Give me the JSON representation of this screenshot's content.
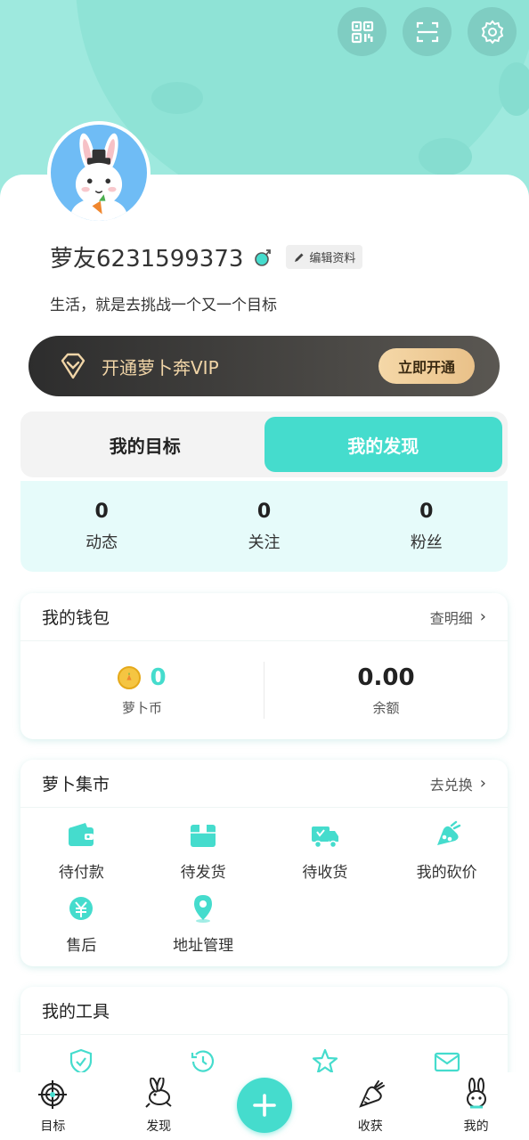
{
  "colors": {
    "accent": "#45dccd",
    "hero_bg": "#9ee9de",
    "vip_gold": "#f1d5a7"
  },
  "header": {
    "icons": [
      "qrcode-icon",
      "scan-icon",
      "settings-icon"
    ]
  },
  "profile": {
    "username": "萝友6231599373",
    "edit_label": "编辑资料",
    "bio": "生活，就是去挑战一个又一个目标"
  },
  "vip": {
    "text": "开通萝卜奔VIP",
    "button": "立即开通"
  },
  "tabs": [
    {
      "label": "我的目标",
      "active": false
    },
    {
      "label": "我的发现",
      "active": true
    }
  ],
  "stats": [
    {
      "value": "0",
      "label": "动态"
    },
    {
      "value": "0",
      "label": "关注"
    },
    {
      "value": "0",
      "label": "粉丝"
    }
  ],
  "wallet": {
    "title": "我的钱包",
    "link": "查明细",
    "coins_value": "0",
    "coins_label": "萝卜币",
    "balance_value": "0.00",
    "balance_label": "余额"
  },
  "market": {
    "title": "萝卜集市",
    "link": "去兑换",
    "items": [
      {
        "label": "待付款",
        "icon": "wallet-icon"
      },
      {
        "label": "待发货",
        "icon": "package-icon"
      },
      {
        "label": "待收货",
        "icon": "truck-icon"
      },
      {
        "label": "我的砍价",
        "icon": "bargain-icon"
      },
      {
        "label": "售后",
        "icon": "after-sale-icon"
      },
      {
        "label": "地址管理",
        "icon": "location-icon"
      }
    ]
  },
  "tools": {
    "title": "我的工具",
    "icons": [
      "shield-check-icon",
      "history-icon",
      "star-icon",
      "mail-icon"
    ]
  },
  "bottom_nav": [
    {
      "label": "目标",
      "icon": "target-icon"
    },
    {
      "label": "发现",
      "icon": "rabbit-run-icon"
    },
    {
      "label": "",
      "icon": "plus-icon"
    },
    {
      "label": "收获",
      "icon": "carrot-harvest-icon"
    },
    {
      "label": "我的",
      "icon": "rabbit-me-icon"
    }
  ]
}
